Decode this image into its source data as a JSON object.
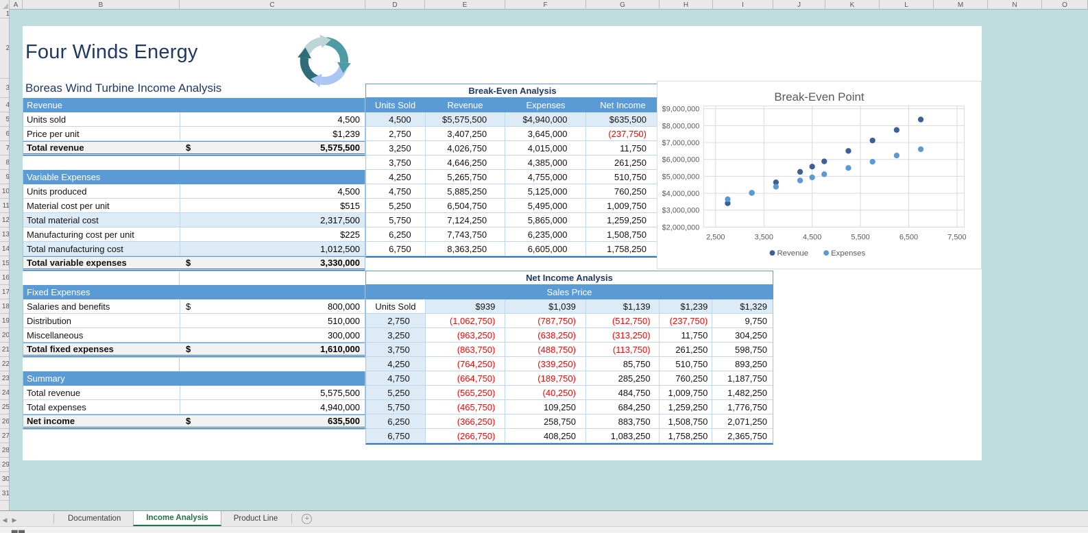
{
  "sheet": {
    "columns": [
      "A",
      "B",
      "C",
      "D",
      "E",
      "F",
      "G",
      "H",
      "I",
      "J",
      "K",
      "L",
      "M",
      "N",
      "O"
    ],
    "row_count": 31
  },
  "header": {
    "title": "Four Winds Energy",
    "subtitle": "Boreas Wind Turbine Income Analysis"
  },
  "left_tables": {
    "sections": [
      {
        "header": "Revenue",
        "rows": [
          {
            "label": "Units sold",
            "prefix": "",
            "value": "4,500",
            "variant": "white"
          },
          {
            "label": "Price per unit",
            "prefix": "",
            "value": "$1,239",
            "variant": "white"
          },
          {
            "label": "Total revenue",
            "prefix": "$",
            "value": "5,575,500",
            "variant": "total"
          }
        ]
      },
      {
        "header": "Variable Expenses",
        "rows": [
          {
            "label": "Units produced",
            "prefix": "",
            "value": "4,500",
            "variant": "white"
          },
          {
            "label": "Material cost per unit",
            "prefix": "",
            "value": "$515",
            "variant": "white"
          },
          {
            "label": "Total material cost",
            "prefix": "",
            "value": "2,317,500",
            "variant": "blue"
          },
          {
            "label": "Manufacturing cost per unit",
            "prefix": "",
            "value": "$225",
            "variant": "white"
          },
          {
            "label": "Total manufacturing cost",
            "prefix": "",
            "value": "1,012,500",
            "variant": "blue"
          },
          {
            "label": "Total variable expenses",
            "prefix": "$",
            "value": "3,330,000",
            "variant": "total"
          }
        ]
      },
      {
        "header": "Fixed Expenses",
        "rows": [
          {
            "label": "Salaries and benefits",
            "prefix": "$",
            "value": "800,000",
            "variant": "white"
          },
          {
            "label": "Distribution",
            "prefix": "",
            "value": "510,000",
            "variant": "white"
          },
          {
            "label": "Miscellaneous",
            "prefix": "",
            "value": "300,000",
            "variant": "white"
          },
          {
            "label": "Total fixed expenses",
            "prefix": "$",
            "value": "1,610,000",
            "variant": "total"
          }
        ]
      },
      {
        "header": "Summary",
        "rows": [
          {
            "label": "Total revenue",
            "prefix": "",
            "value": "5,575,500",
            "variant": "white"
          },
          {
            "label": "Total expenses",
            "prefix": "",
            "value": "4,940,000",
            "variant": "white"
          },
          {
            "label": "Net income",
            "prefix": "$",
            "value": "635,500",
            "variant": "total"
          }
        ]
      }
    ]
  },
  "breakeven_table": {
    "title": "Break-Even Analysis",
    "headers": [
      "Units Sold",
      "Revenue",
      "Expenses",
      "Net Income"
    ],
    "highlight_row": 0,
    "rows": [
      [
        "4,500",
        "$5,575,500",
        "$4,940,000",
        "$635,500"
      ],
      [
        "2,750",
        "3,407,250",
        "3,645,000",
        "(237,750)"
      ],
      [
        "3,250",
        "4,026,750",
        "4,015,000",
        "11,750"
      ],
      [
        "3,750",
        "4,646,250",
        "4,385,000",
        "261,250"
      ],
      [
        "4,250",
        "5,265,750",
        "4,755,000",
        "510,750"
      ],
      [
        "4,750",
        "5,885,250",
        "5,125,000",
        "760,250"
      ],
      [
        "5,250",
        "6,504,750",
        "5,495,000",
        "1,009,750"
      ],
      [
        "5,750",
        "7,124,250",
        "5,865,000",
        "1,259,250"
      ],
      [
        "6,250",
        "7,743,750",
        "6,235,000",
        "1,508,750"
      ],
      [
        "6,750",
        "8,363,250",
        "6,605,000",
        "1,758,250"
      ]
    ]
  },
  "net_income_table": {
    "title": "Net Income Analysis",
    "band_header": "Sales Price",
    "row_header": "Units Sold",
    "price_columns": [
      "$939",
      "$1,039",
      "$1,139",
      "$1,239",
      "$1,329"
    ],
    "rows": [
      {
        "units": "2,750",
        "values": [
          "(1,062,750)",
          "(787,750)",
          "(512,750)",
          "(237,750)",
          "9,750"
        ]
      },
      {
        "units": "3,250",
        "values": [
          "(963,250)",
          "(638,250)",
          "(313,250)",
          "11,750",
          "304,250"
        ]
      },
      {
        "units": "3,750",
        "values": [
          "(863,750)",
          "(488,750)",
          "(113,750)",
          "261,250",
          "598,750"
        ]
      },
      {
        "units": "4,250",
        "values": [
          "(764,250)",
          "(339,250)",
          "85,750",
          "510,750",
          "893,250"
        ]
      },
      {
        "units": "4,750",
        "values": [
          "(664,750)",
          "(189,750)",
          "285,250",
          "760,250",
          "1,187,750"
        ]
      },
      {
        "units": "5,250",
        "values": [
          "(565,250)",
          "(40,250)",
          "484,750",
          "1,009,750",
          "1,482,250"
        ]
      },
      {
        "units": "5,750",
        "values": [
          "(465,750)",
          "109,250",
          "684,250",
          "1,259,250",
          "1,776,750"
        ]
      },
      {
        "units": "6,250",
        "values": [
          "(366,250)",
          "258,750",
          "883,750",
          "1,508,750",
          "2,071,250"
        ]
      },
      {
        "units": "6,750",
        "values": [
          "(266,750)",
          "408,250",
          "1,083,250",
          "1,758,250",
          "2,365,750"
        ]
      }
    ]
  },
  "chart_data": {
    "type": "scatter",
    "title": "Break-Even Point",
    "xlabel": "",
    "ylabel": "",
    "xlim": [
      2250,
      7650
    ],
    "ylim": [
      2000000,
      9000000
    ],
    "grid": true,
    "legend_position": "bottom",
    "x_ticks": [
      2500,
      3500,
      4500,
      5500,
      6500,
      7500
    ],
    "x_tick_labels": [
      "2,500",
      "3,500",
      "4,500",
      "5,500",
      "6,500",
      "7,500"
    ],
    "y_ticks": [
      2000000,
      3000000,
      4000000,
      5000000,
      6000000,
      7000000,
      8000000,
      9000000
    ],
    "y_tick_labels": [
      "$2,000,000",
      "$3,000,000",
      "$4,000,000",
      "$5,000,000",
      "$6,000,000",
      "$7,000,000",
      "$8,000,000",
      "$9,000,000"
    ],
    "series": [
      {
        "name": "Revenue",
        "color": "#3e5f96",
        "x": [
          2750,
          3250,
          3750,
          4250,
          4500,
          4750,
          5250,
          5750,
          6250,
          6750
        ],
        "y": [
          3407250,
          4026750,
          4646250,
          5265750,
          5575500,
          5885250,
          6504750,
          7124250,
          7743750,
          8363250
        ]
      },
      {
        "name": "Expenses",
        "color": "#5b9bd5",
        "x": [
          2750,
          3250,
          3750,
          4250,
          4500,
          4750,
          5250,
          5750,
          6250,
          6750
        ],
        "y": [
          3645000,
          4015000,
          4385000,
          4755000,
          4940000,
          5125000,
          5495000,
          5865000,
          6235000,
          6605000
        ]
      }
    ]
  },
  "tabs": {
    "items": [
      {
        "label": "Documentation",
        "active": false
      },
      {
        "label": "Income Analysis",
        "active": true
      },
      {
        "label": "Product Line",
        "active": false
      }
    ]
  },
  "icons": {
    "logo": "cycle-arrows-logo",
    "sheet_nav_left": "left-triangle",
    "sheet_nav_right": "right-triangle",
    "add_sheet": "plus-circle",
    "scroll_left": "left-triangle",
    "scroll_right": "right-triangle",
    "select_all": "corner-triangle"
  },
  "colors": {
    "accent_blue": "#5b9bd5",
    "light_blue_fill": "#ddebf7",
    "total_fill": "#f2f2f2",
    "strong_border": "#2e75b6",
    "row_border": "#bdd7ee",
    "negative": "#ff0000",
    "navy": "#1f3864",
    "tab_active_green": "#217346",
    "canvas_teal": "#bfdcdf",
    "logo_pale": "#bdd4d8",
    "logo_teal": "#4e9ba6",
    "logo_light_blue": "#abc6f2",
    "logo_dark_teal": "#2f6d7a"
  }
}
